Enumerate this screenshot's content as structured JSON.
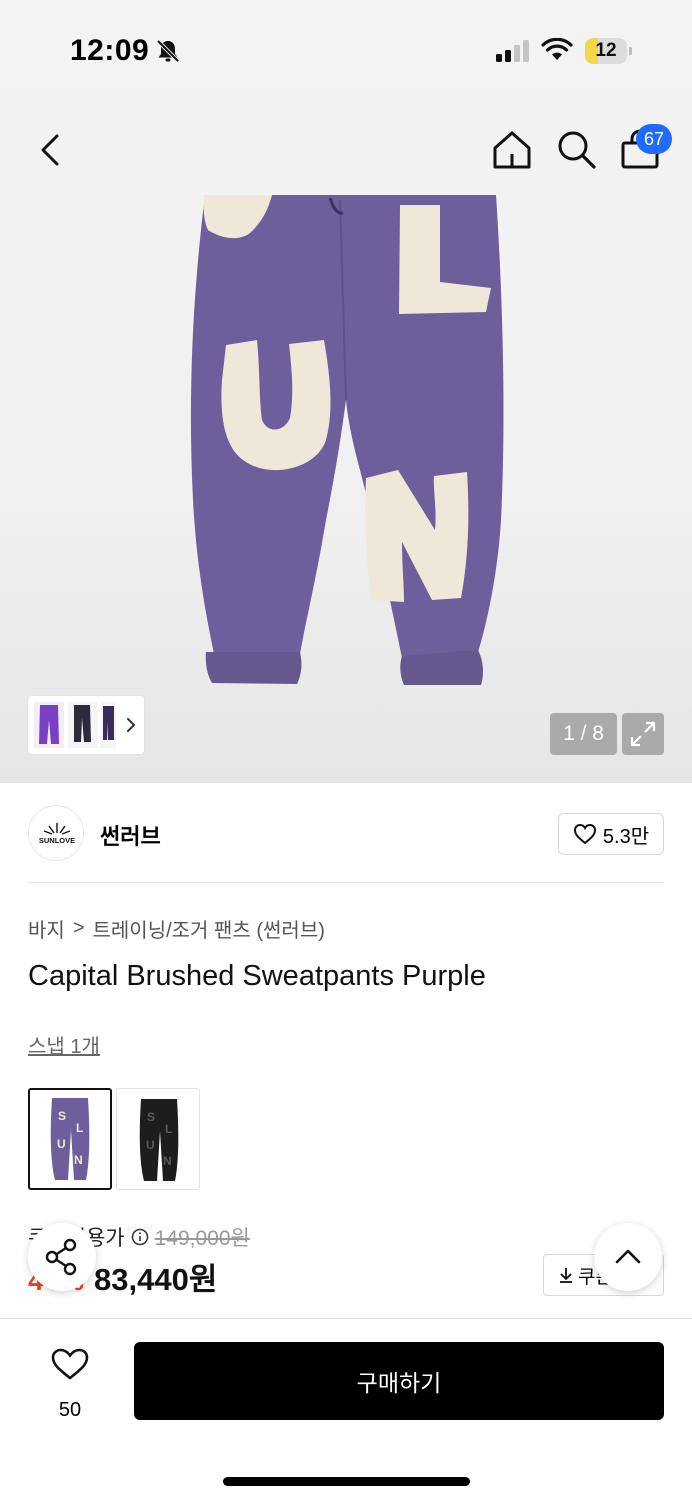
{
  "status_bar": {
    "time": "12:09",
    "battery": "12"
  },
  "header": {
    "cart_count": "67"
  },
  "gallery": {
    "counter": "1 / 8",
    "pants_color": "#6f5e9c",
    "patch_color": "#efe7d8",
    "letters": [
      "S",
      "L",
      "U",
      "N"
    ]
  },
  "brand": {
    "name": "썬러브",
    "logo_text": "SUNLOVE",
    "likes": "5.3만"
  },
  "breadcrumb": {
    "category": "바지",
    "separator": ">",
    "subcategory": "트레이닝/조거 팬츠 (썬러브)"
  },
  "product": {
    "title": "Capital Brushed Sweatpants Purple",
    "snap_link": "스냅 1개",
    "price_label": "쿠폰적용가",
    "original_price": "149,000원",
    "discount": "44%",
    "final_price": "83,440원",
    "coupon_label": "쿠폰"
  },
  "bottom_bar": {
    "wish_count": "50",
    "buy_label": "구매하기"
  }
}
